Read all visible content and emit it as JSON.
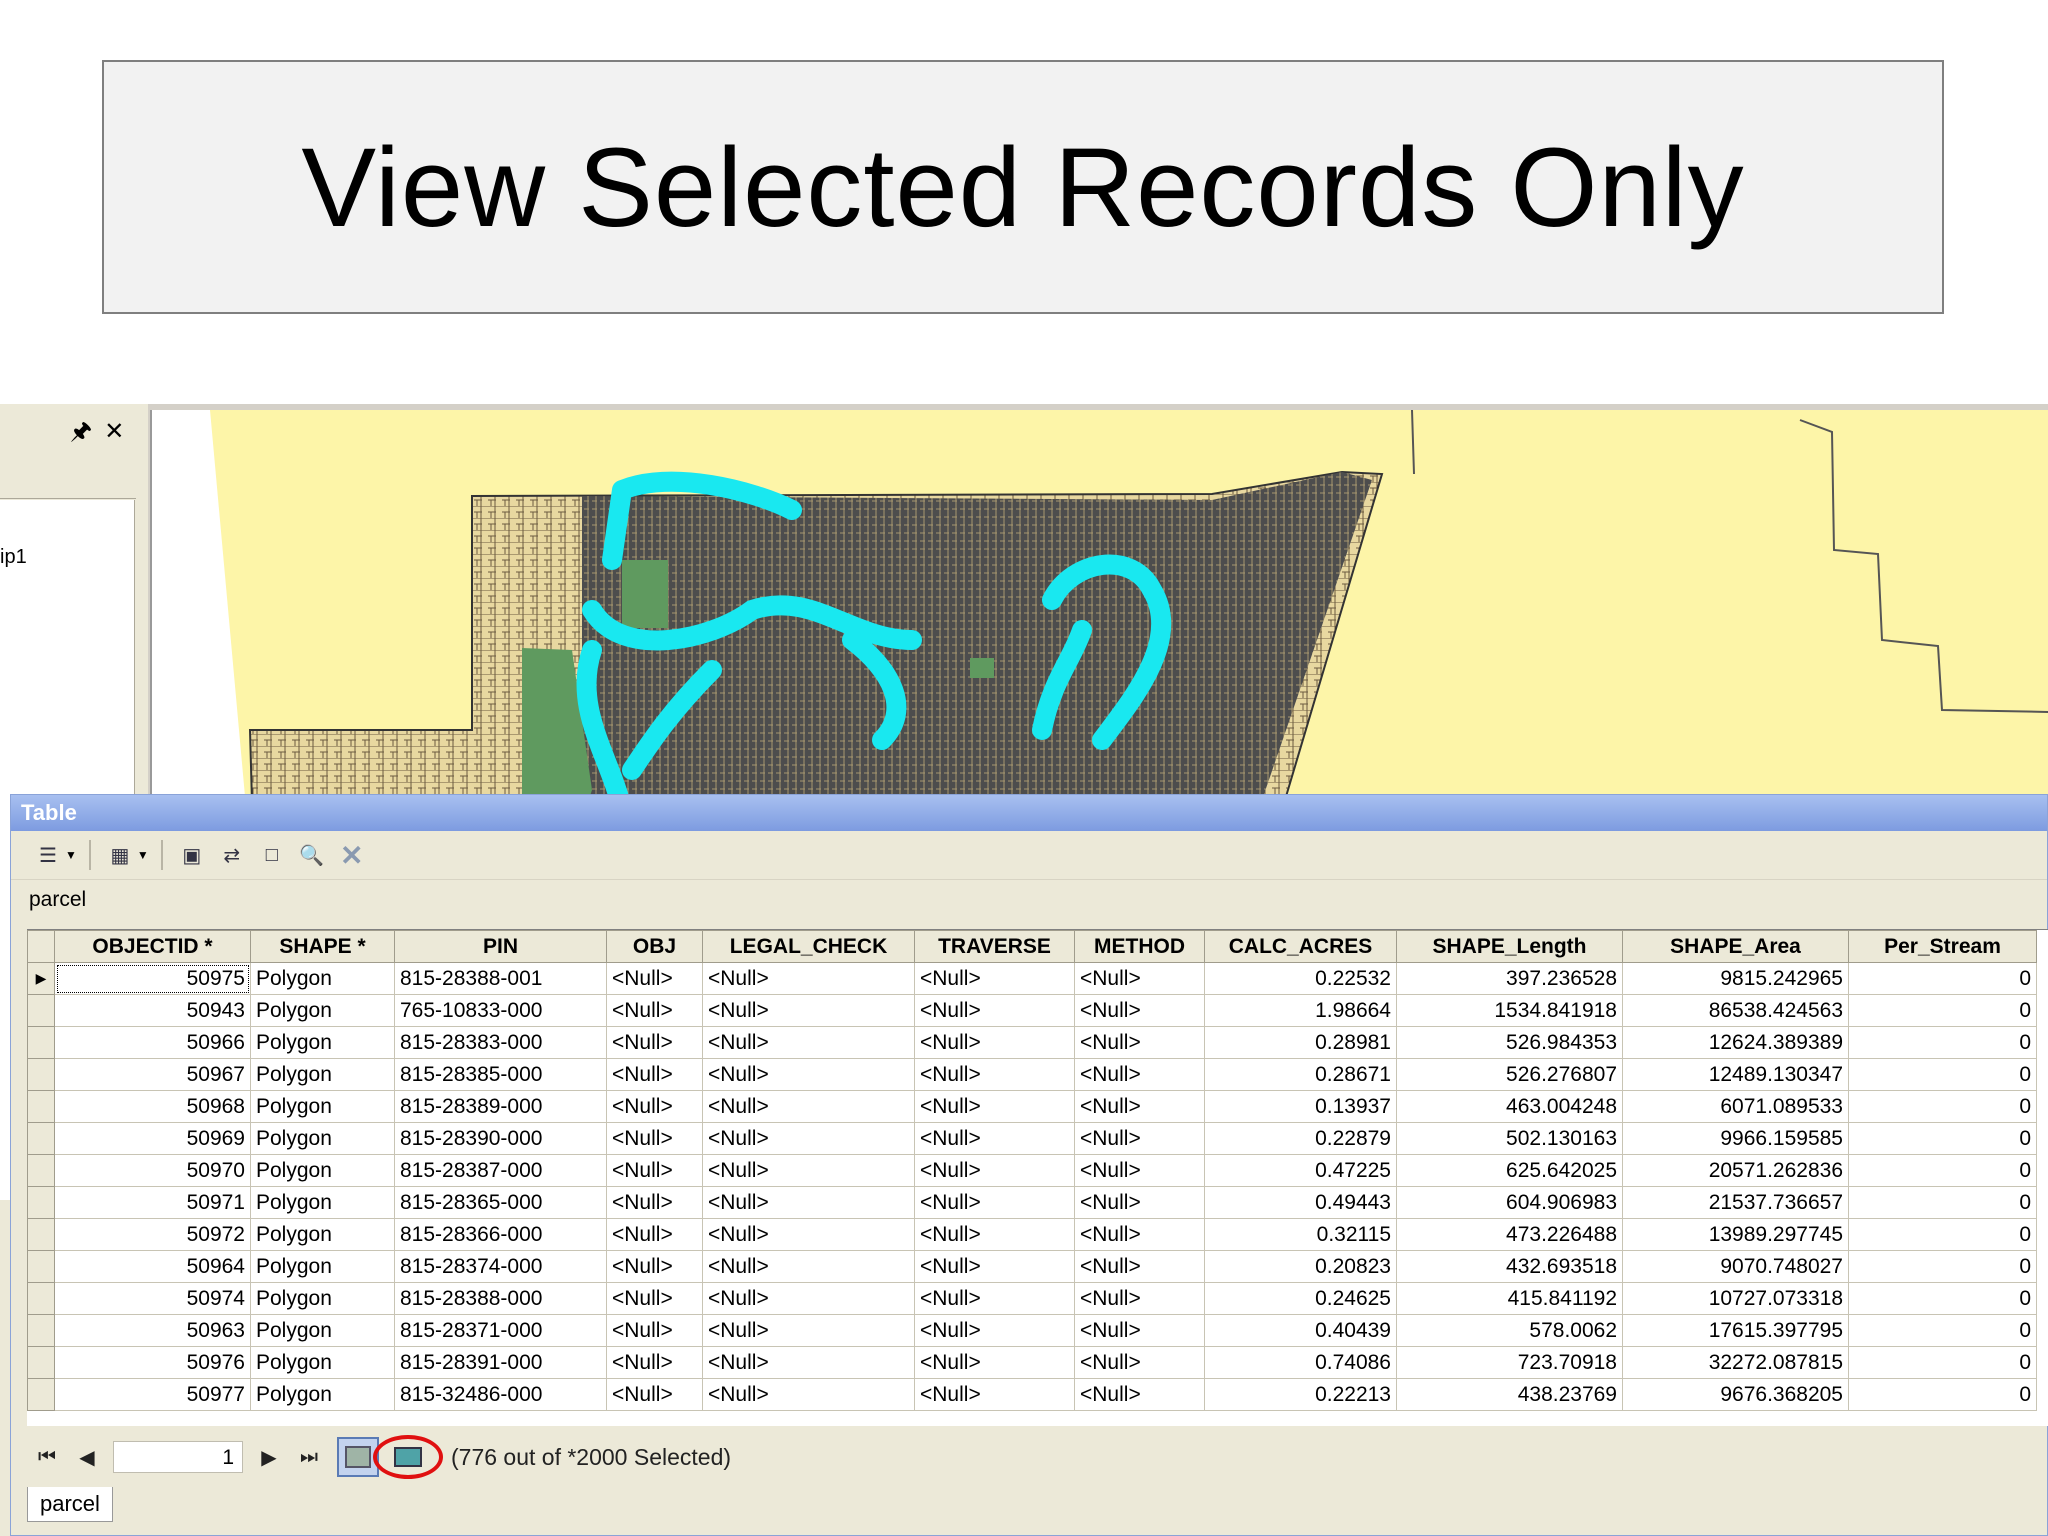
{
  "slide": {
    "title": "View Selected Records Only"
  },
  "toc": {
    "pin_icon": "↑",
    "close_icon": "✕",
    "layer_label": "ip1"
  },
  "table_window": {
    "title": "Table",
    "table_name": "parcel",
    "columns": [
      "OBJECTID *",
      "SHAPE *",
      "PIN",
      "OBJ",
      "LEGAL_CHECK",
      "TRAVERSE",
      "METHOD",
      "CALC_ACRES",
      "SHAPE_Length",
      "SHAPE_Area",
      "Per_Stream"
    ],
    "rows": [
      [
        "50975",
        "Polygon",
        "815-28388-001",
        "<Null>",
        "<Null>",
        "<Null>",
        "<Null>",
        "0.22532",
        "397.236528",
        "9815.242965",
        "0"
      ],
      [
        "50943",
        "Polygon",
        "765-10833-000",
        "<Null>",
        "<Null>",
        "<Null>",
        "<Null>",
        "1.98664",
        "1534.841918",
        "86538.424563",
        "0"
      ],
      [
        "50966",
        "Polygon",
        "815-28383-000",
        "<Null>",
        "<Null>",
        "<Null>",
        "<Null>",
        "0.28981",
        "526.984353",
        "12624.389389",
        "0"
      ],
      [
        "50967",
        "Polygon",
        "815-28385-000",
        "<Null>",
        "<Null>",
        "<Null>",
        "<Null>",
        "0.28671",
        "526.276807",
        "12489.130347",
        "0"
      ],
      [
        "50968",
        "Polygon",
        "815-28389-000",
        "<Null>",
        "<Null>",
        "<Null>",
        "<Null>",
        "0.13937",
        "463.004248",
        "6071.089533",
        "0"
      ],
      [
        "50969",
        "Polygon",
        "815-28390-000",
        "<Null>",
        "<Null>",
        "<Null>",
        "<Null>",
        "0.22879",
        "502.130163",
        "9966.159585",
        "0"
      ],
      [
        "50970",
        "Polygon",
        "815-28387-000",
        "<Null>",
        "<Null>",
        "<Null>",
        "<Null>",
        "0.47225",
        "625.642025",
        "20571.262836",
        "0"
      ],
      [
        "50971",
        "Polygon",
        "815-28365-000",
        "<Null>",
        "<Null>",
        "<Null>",
        "<Null>",
        "0.49443",
        "604.906983",
        "21537.736657",
        "0"
      ],
      [
        "50972",
        "Polygon",
        "815-28366-000",
        "<Null>",
        "<Null>",
        "<Null>",
        "<Null>",
        "0.32115",
        "473.226488",
        "13989.297745",
        "0"
      ],
      [
        "50964",
        "Polygon",
        "815-28374-000",
        "<Null>",
        "<Null>",
        "<Null>",
        "<Null>",
        "0.20823",
        "432.693518",
        "9070.748027",
        "0"
      ],
      [
        "50974",
        "Polygon",
        "815-28388-000",
        "<Null>",
        "<Null>",
        "<Null>",
        "<Null>",
        "0.24625",
        "415.841192",
        "10727.073318",
        "0"
      ],
      [
        "50963",
        "Polygon",
        "815-28371-000",
        "<Null>",
        "<Null>",
        "<Null>",
        "<Null>",
        "0.40439",
        "578.0062",
        "17615.397795",
        "0"
      ],
      [
        "50976",
        "Polygon",
        "815-28391-000",
        "<Null>",
        "<Null>",
        "<Null>",
        "<Null>",
        "0.74086",
        "723.70918",
        "32272.087815",
        "0"
      ],
      [
        "50977",
        "Polygon",
        "815-32486-000",
        "<Null>",
        "<Null>",
        "<Null>",
        "<Null>",
        "0.22213",
        "438.23769",
        "9676.368205",
        "0"
      ]
    ],
    "navigation": {
      "current_record": "1",
      "status": "(776 out of *2000 Selected)",
      "first_icon": "⏮",
      "prev_icon": "◀",
      "next_icon": "▶",
      "last_icon": "⏭"
    },
    "tabs": [
      "parcel"
    ]
  },
  "colors": {
    "map_background": "#fdf5a8",
    "parcel_fill": "#e8d8a0",
    "dense_parcels": "#555555",
    "selected_stream": "#19e8f0",
    "park_green": "#5f9a5f",
    "highlight_circle": "#e01010"
  }
}
